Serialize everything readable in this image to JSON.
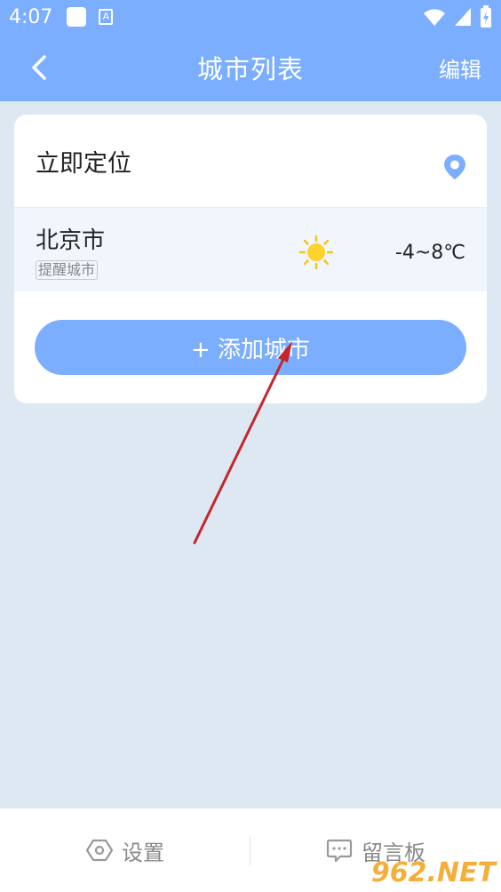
{
  "status_bar": {
    "time": "4:07",
    "a_icon_letter": "A"
  },
  "nav": {
    "title": "城市列表",
    "edit_label": "编辑"
  },
  "locate": {
    "label": "立即定位"
  },
  "city": {
    "name": "北京市",
    "tag": "提醒城市",
    "weather_icon": "sun-icon",
    "temp": "-4~8℃"
  },
  "add_button": {
    "label": "+ 添加城市"
  },
  "tabs": [
    {
      "label": "设置",
      "icon": "gear-hexagon-icon"
    },
    {
      "label": "留言板",
      "icon": "chat-bubble-icon"
    }
  ],
  "watermark": {
    "text": "962.NET"
  },
  "colors": {
    "accent": "#7baeff",
    "background": "#dde8f3",
    "arrow": "#c4262e"
  }
}
